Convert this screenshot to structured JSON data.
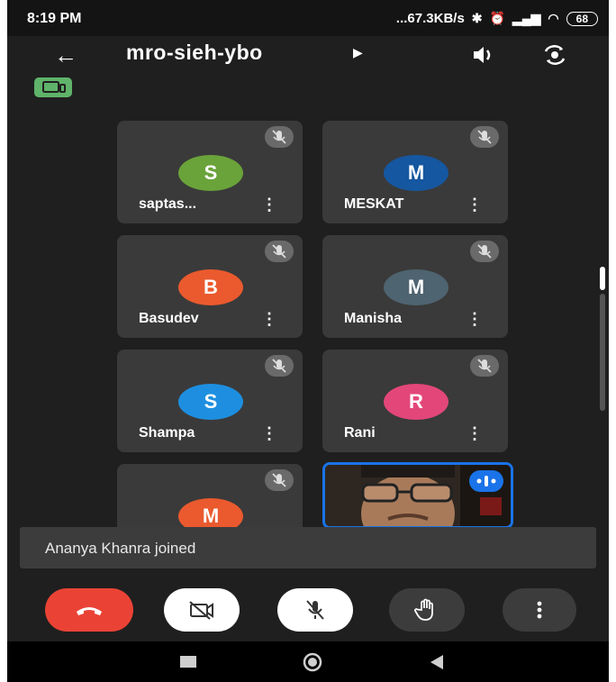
{
  "status_bar": {
    "time": "8:19 PM",
    "net_speed": "...67.3KB/s",
    "battery": "68"
  },
  "header": {
    "meeting_code": "mro-sieh-ybo"
  },
  "participants": [
    {
      "initial": "S",
      "name": "saptas...",
      "color": "#6aa33a"
    },
    {
      "initial": "M",
      "name": "MESKAT",
      "color": "#1557a0"
    },
    {
      "initial": "B",
      "name": "Basudev",
      "color": "#ea5a2e"
    },
    {
      "initial": "M",
      "name": "Manisha",
      "color": "#4e6470"
    },
    {
      "initial": "S",
      "name": "Shampa",
      "color": "#1e8fe0"
    },
    {
      "initial": "R",
      "name": "Rani",
      "color": "#e3477a"
    },
    {
      "initial": "M",
      "name": "",
      "color": "#ea5a2e"
    }
  ],
  "toast": {
    "message": "Ananya Khanra joined"
  },
  "controls": {
    "end_color": "#ea4335",
    "icons": [
      "end-call-icon",
      "camera-off-icon",
      "mic-off-icon",
      "raise-hand-icon",
      "more-vert-icon"
    ]
  },
  "colors": {
    "background": "#1f1f1f",
    "tile": "#3a3a3a",
    "accent": "#1a73e8"
  }
}
